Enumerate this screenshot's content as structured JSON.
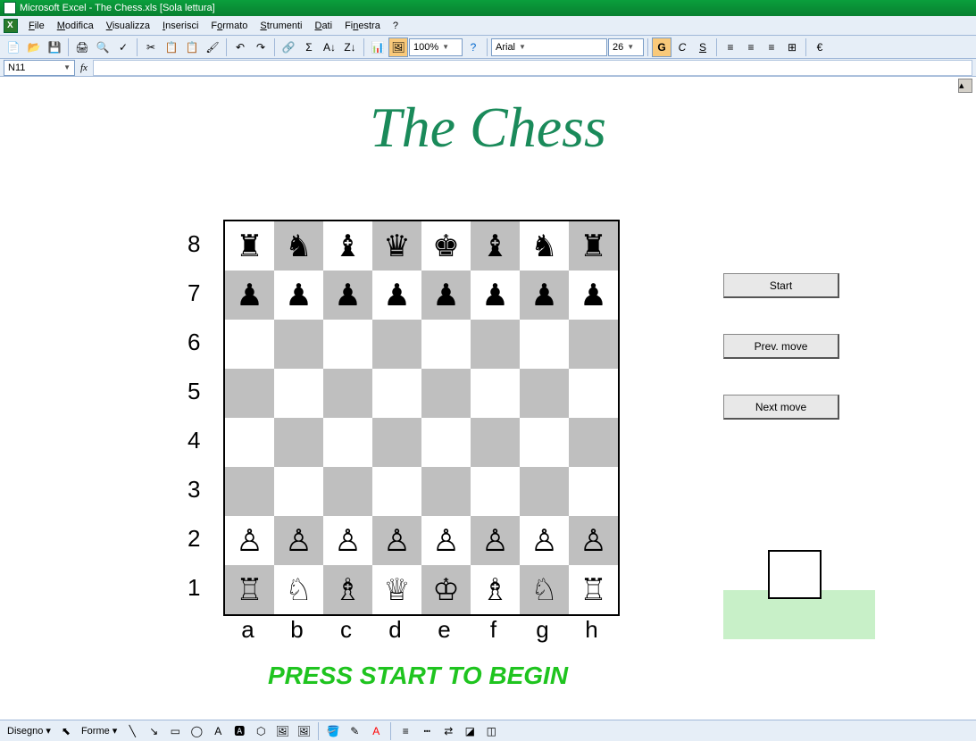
{
  "titlebar": {
    "text": "Microsoft Excel - The Chess.xls  [Sola lettura]"
  },
  "menubar": {
    "items": [
      {
        "label": "File",
        "u": "F"
      },
      {
        "label": "Modifica",
        "u": "M"
      },
      {
        "label": "Visualizza",
        "u": "V"
      },
      {
        "label": "Inserisci",
        "u": "I"
      },
      {
        "label": "Formato",
        "u": "o"
      },
      {
        "label": "Strumenti",
        "u": "S"
      },
      {
        "label": "Dati",
        "u": "D"
      },
      {
        "label": "Finestra",
        "u": "n"
      },
      {
        "label": "?",
        "u": "?"
      }
    ]
  },
  "toolbar": {
    "zoom": "100%",
    "font": "Arial",
    "fontsize": "26"
  },
  "namebox": {
    "cell": "N11"
  },
  "sheet": {
    "title": "The Chess",
    "instruction": "PRESS START TO BEGIN",
    "ranks": [
      "8",
      "7",
      "6",
      "5",
      "4",
      "3",
      "2",
      "1"
    ],
    "files": [
      "a",
      "b",
      "c",
      "d",
      "e",
      "f",
      "g",
      "h"
    ]
  },
  "board": {
    "rows": [
      [
        "♜",
        "♞",
        "♝",
        "♛",
        "♚",
        "♝",
        "♞",
        "♜"
      ],
      [
        "♟",
        "♟",
        "♟",
        "♟",
        "♟",
        "♟",
        "♟",
        "♟"
      ],
      [
        "",
        "",
        "",
        "",
        "",
        "",
        "",
        ""
      ],
      [
        "",
        "",
        "",
        "",
        "",
        "",
        "",
        ""
      ],
      [
        "",
        "",
        "",
        "",
        "",
        "",
        "",
        ""
      ],
      [
        "",
        "",
        "",
        "",
        "",
        "",
        "",
        ""
      ],
      [
        "♙",
        "♙",
        "♙",
        "♙",
        "♙",
        "♙",
        "♙",
        "♙"
      ],
      [
        "♖",
        "♘",
        "♗",
        "♕",
        "♔",
        "♗",
        "♘",
        "♖"
      ]
    ]
  },
  "buttons": {
    "start": "Start",
    "prev": "Prev. move",
    "next": "Next move"
  },
  "bottom": {
    "disegno": "Disegno",
    "forme": "Forme"
  }
}
